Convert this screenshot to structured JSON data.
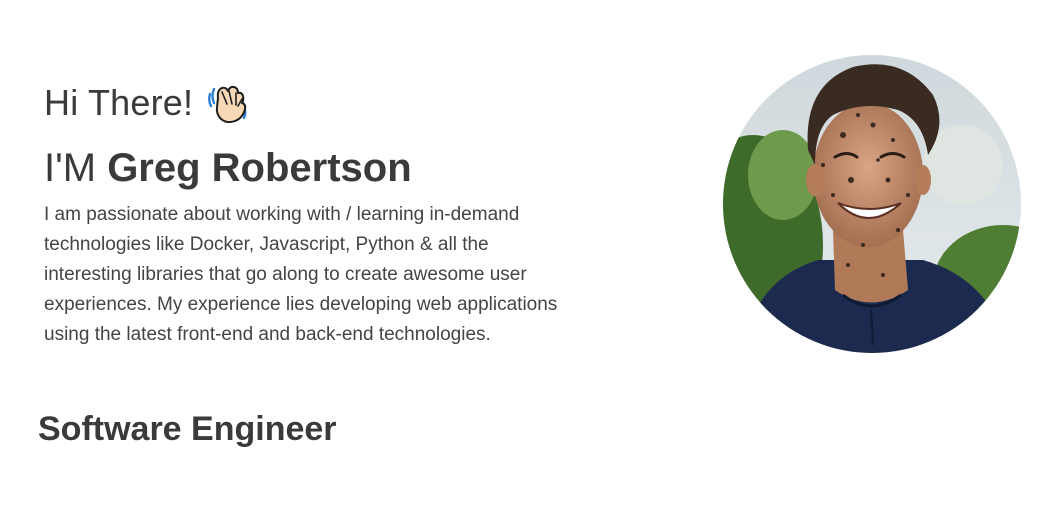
{
  "hero": {
    "greeting": "Hi There!",
    "wave_icon": "waving-hand-icon",
    "name_prefix": "I'M ",
    "name": "Greg Robertson",
    "bio": "I am passionate about working with / learning in-demand technologies like Docker, Javascript, Python & all the interesting libraries that go along to create awesome user experiences. My experience lies developing web applications using the latest front-end and back-end technologies.",
    "role": "Software Engineer",
    "avatar_icon": "profile-photo"
  },
  "colors": {
    "text": "#3a3a3a",
    "background": "#ffffff"
  }
}
